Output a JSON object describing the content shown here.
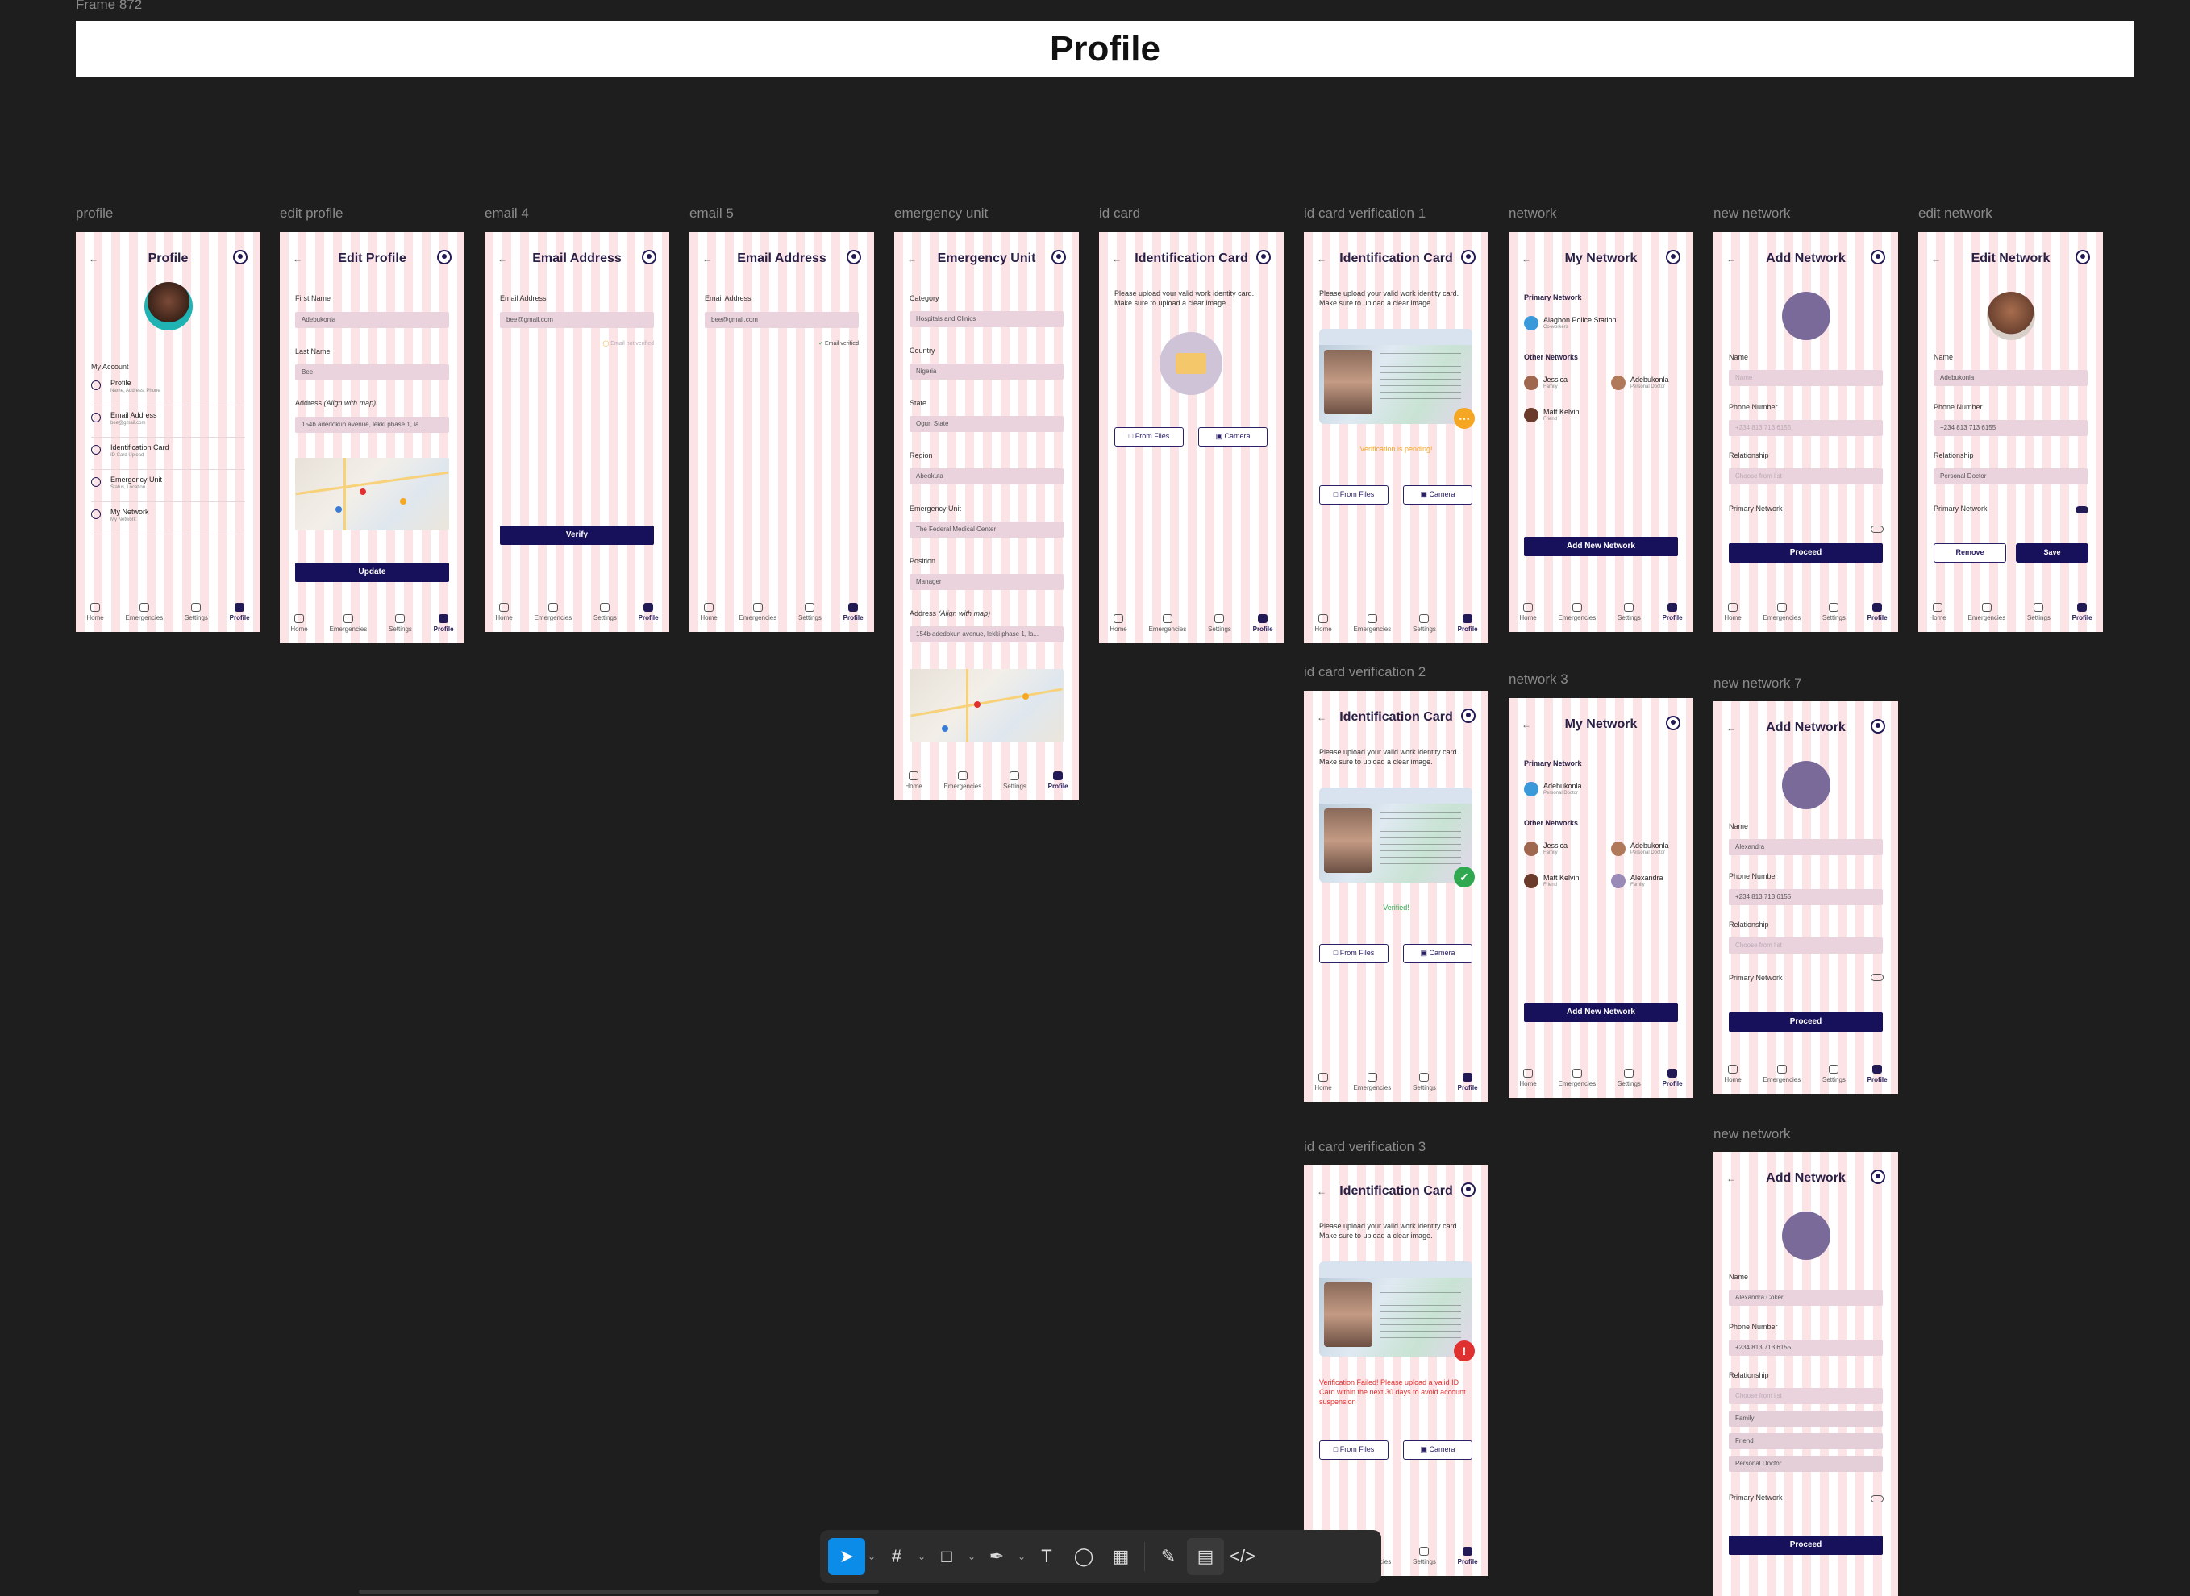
{
  "canvas": {
    "frame_name": "Frame 872",
    "banner_title": "Profile"
  },
  "frame_labels": {
    "profile": "profile",
    "edit_profile": "edit profile",
    "email4": "email 4",
    "email5": "email 5",
    "emergency": "emergency unit",
    "idcard": "id card",
    "idv1": "id card verification 1",
    "idv2": "id card verification 2",
    "idv3": "id card verification 3",
    "network": "network",
    "network3": "network 3",
    "new_network": "new network",
    "new_network7": "new network 7",
    "new_network_b": "new network",
    "edit_network": "edit network"
  },
  "nav": {
    "home": "Home",
    "emergencies": "Emergencies",
    "settings": "Settings",
    "profile": "Profile"
  },
  "profile": {
    "title": "Profile",
    "section": "My Account",
    "items": [
      {
        "label": "Profile",
        "sub": "Name, Address, Phone"
      },
      {
        "label": "Email Address",
        "sub": "bee@gmail.com"
      },
      {
        "label": "Identification Card",
        "sub": "ID Card Upload"
      },
      {
        "label": "Emergency Unit",
        "sub": "Status, Location"
      },
      {
        "label": "My Network",
        "sub": "My Network"
      }
    ]
  },
  "edit_profile": {
    "title": "Edit Profile",
    "first_name_label": "First Name",
    "first_name": "Adebukonla",
    "last_name_label": "Last Name",
    "last_name": "Bee",
    "address_label": "Address",
    "address_hint": "(Align with map)",
    "address": "154b adedokun avenue, lekki phase 1, la...",
    "button": "Update"
  },
  "email4": {
    "title": "Email Address",
    "label": "Email Address",
    "value": "bee@gmail.com",
    "status": "Email not verified",
    "button": "Verify"
  },
  "email5": {
    "title": "Email Address",
    "label": "Email Address",
    "value": "bee@gmail.com",
    "status": "Email verified"
  },
  "emergency": {
    "title": "Emergency Unit",
    "fields": [
      {
        "label": "Category",
        "value": "Hospitals and Clinics"
      },
      {
        "label": "Country",
        "value": "Nigeria"
      },
      {
        "label": "State",
        "value": "Ogun State"
      },
      {
        "label": "Region",
        "value": "Abeokuta"
      },
      {
        "label": "Emergency Unit",
        "value": "The Federal Medical Center"
      },
      {
        "label": "Position",
        "value": "Manager"
      }
    ],
    "address_label": "Address",
    "address_hint": "(Align with map)",
    "address": "154b adedokun avenue, lekki phase 1, la..."
  },
  "idcard": {
    "title": "Identification Card",
    "instructions": "Please upload your valid work identity card. Make sure to upload a clear image.",
    "from_files": "From Files",
    "camera": "Camera",
    "pending": "Verification is pending!",
    "verified": "Verified!",
    "failed": "Verification Failed! Please upload a valid ID Card within the next 30 days to avoid account suspension"
  },
  "network": {
    "title": "My Network",
    "primary": "Primary Network",
    "other": "Other Networks",
    "primary_name": "Alagbon Police Station",
    "primary_sub": "Co-workers",
    "primary_name3": "Adebukonla",
    "primary_sub3": "Personal Doctor",
    "people": [
      {
        "name": "Jessica",
        "rel": "Family"
      },
      {
        "name": "Adebukonla",
        "rel": "Personal Doctor"
      },
      {
        "name": "Matt Kelvin",
        "rel": "Friend"
      },
      {
        "name": "Alexandra",
        "rel": "Family"
      }
    ],
    "button": "Add New Network"
  },
  "add_network": {
    "title": "Add Network",
    "name_label": "Name",
    "name_ph": "Name",
    "phone_label": "Phone Number",
    "phone_ph": "+234 813 713 6155",
    "relationship_label": "Relationship",
    "relationship_ph": "Choose from list",
    "primary_label": "Primary Network",
    "button": "Proceed",
    "name7": "Alexandra",
    "phone7": "+234 813 713 6155",
    "name_b": "Alexandra Coker",
    "phone_b": "+234 813 713 6155",
    "options": [
      "Family",
      "Friend",
      "Personal Doctor"
    ]
  },
  "edit_network": {
    "title": "Edit Network",
    "name_label": "Name",
    "name": "Adebukonla",
    "phone_label": "Phone Number",
    "phone": "+234 813 713 6155",
    "relationship_label": "Relationship",
    "relationship": "Personal Doctor",
    "primary_label": "Primary Network",
    "remove": "Remove",
    "save": "Save"
  },
  "colors": {
    "accent": "#17105a",
    "verified": "#2fa84f",
    "pending": "#f5a623",
    "failed": "#e03131",
    "stripe": "#fbe3e6"
  },
  "toolbar": {
    "icons": [
      "move-tool",
      "frame-tool",
      "rectangle-tool",
      "pen-tool",
      "text-tool",
      "comment-tool",
      "actions-tool",
      "draw-mode",
      "design-mode",
      "dev-mode"
    ]
  }
}
